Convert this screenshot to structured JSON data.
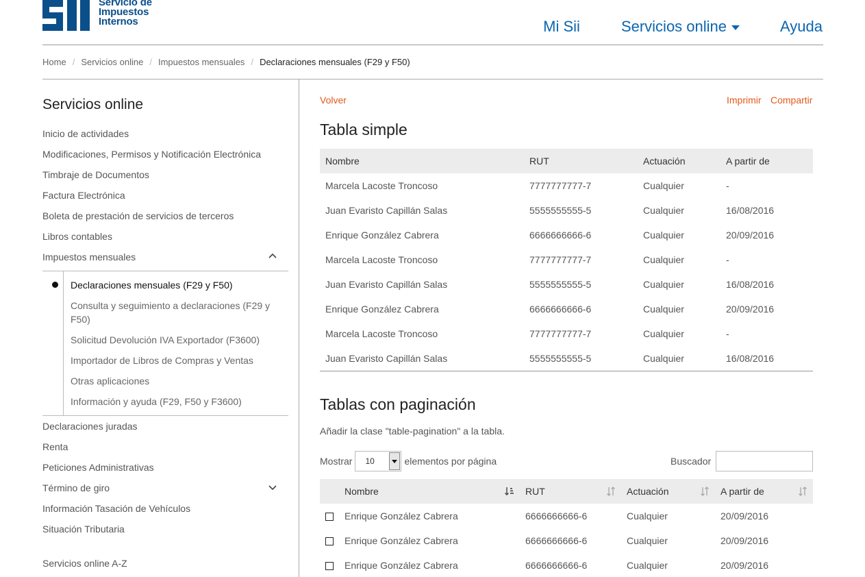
{
  "header": {
    "logo_text": [
      "Servicio de",
      "Impuestos",
      "Internos"
    ],
    "logo_mark": "SII",
    "nav": [
      {
        "label": "Mi Sii"
      },
      {
        "label": "Servicios online"
      },
      {
        "label": "Ayuda"
      }
    ]
  },
  "breadcrumb": [
    "Home",
    "Servicios online",
    "Impuestos mensuales",
    "Declaraciones mensuales (F29 y F50)"
  ],
  "sidebar": {
    "title": "Servicios online",
    "items_top": [
      "Inicio de actividades",
      "Modificaciones, Permisos y Notificación Electrónica",
      "Timbraje de Documentos",
      "Factura Electrónica",
      "Boleta de prestación de servicios de terceros",
      "Libros contables",
      "Impuestos mensuales"
    ],
    "sub_items": [
      "Declaraciones mensuales (F29 y F50)",
      "Consulta y seguimiento a declaraciones (F29 y F50)",
      "Solicitud Devolución IVA Exportador (F3600)",
      "Importador de Libros de Compras y Ventas",
      "Otras aplicaciones",
      "Información y ayuda (F29, F50 y F3600)"
    ],
    "items_bottom": [
      "Declaraciones juradas",
      "Renta",
      "Peticiones Administrativas",
      "Término de giro",
      "Información Tasación de Vehículos",
      "Situación Tributaria"
    ],
    "az_link": "Servicios online A-Z"
  },
  "main": {
    "back": "Volver",
    "print": "Imprimir",
    "share": "Compartir",
    "simple_title": "Tabla simple",
    "columns": [
      "Nombre",
      "RUT",
      "Actuación",
      "A partir de"
    ],
    "simple_rows": [
      [
        "Marcela Lacoste Troncoso",
        "7777777777-7",
        "Cualquier",
        "-"
      ],
      [
        "Juan Evaristo Capillán Salas",
        "5555555555-5",
        "Cualquier",
        "16/08/2016"
      ],
      [
        "Enrique González Cabrera",
        "6666666666-6",
        "Cualquier",
        "20/09/2016"
      ],
      [
        "Marcela Lacoste Troncoso",
        "7777777777-7",
        "Cualquier",
        "-"
      ],
      [
        "Juan Evaristo Capillán Salas",
        "5555555555-5",
        "Cualquier",
        "16/08/2016"
      ],
      [
        "Enrique González Cabrera",
        "6666666666-6",
        "Cualquier",
        "20/09/2016"
      ],
      [
        "Marcela Lacoste Troncoso",
        "7777777777-7",
        "Cualquier",
        "-"
      ],
      [
        "Juan Evaristo Capillán Salas",
        "5555555555-5",
        "Cualquier",
        "16/08/2016"
      ]
    ],
    "pag_title": "Tablas con paginación",
    "pag_desc": "Añadir la clase \"table-pagination\" a la tabla.",
    "show_label": "Mostrar",
    "show_value": "10",
    "per_page_label": "elementos por página",
    "search_label": "Buscador",
    "search_value": "",
    "pag_rows": [
      [
        "Enrique González Cabrera",
        "6666666666-6",
        "Cualquier",
        "20/09/2016"
      ],
      [
        "Enrique González Cabrera",
        "6666666666-6",
        "Cualquier",
        "20/09/2016"
      ],
      [
        "Enrique González Cabrera",
        "6666666666-6",
        "Cualquier",
        "20/09/2016"
      ]
    ],
    "colors": {
      "accent_orange": "#e25a1c",
      "brand_blue": "#0b4f8a",
      "nav_blue": "#0b66b0"
    }
  }
}
